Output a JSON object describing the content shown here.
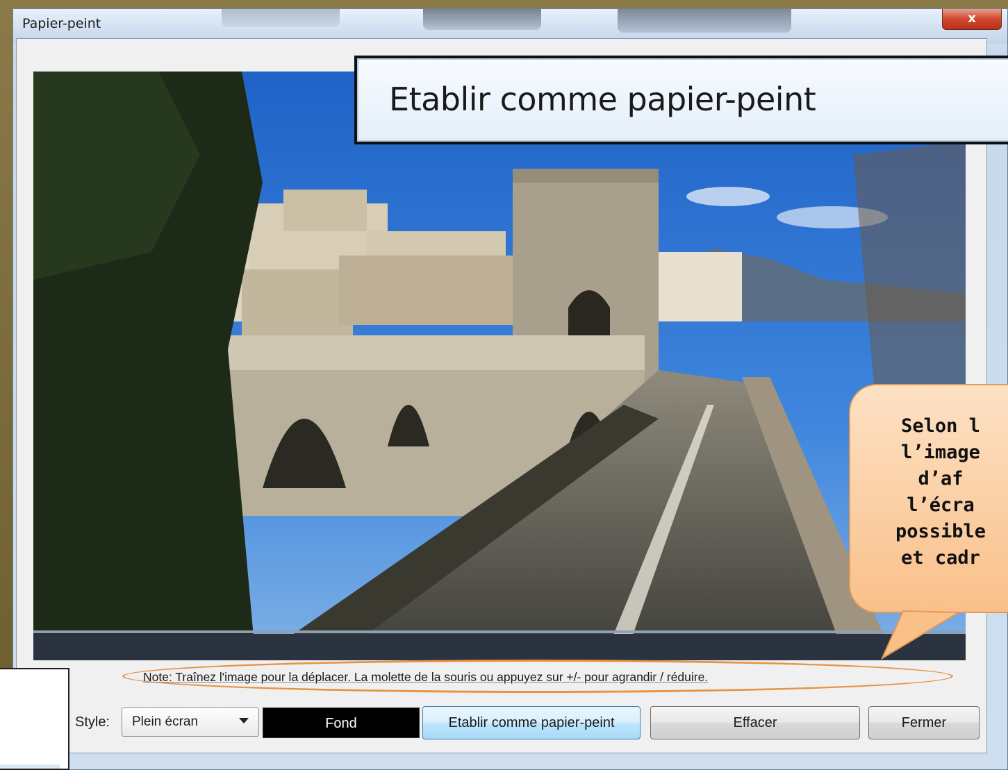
{
  "window": {
    "title": "Papier-peint",
    "close_label": "x"
  },
  "callout_menu": {
    "label": "Etablir comme papier-peint"
  },
  "bubble": {
    "lines": [
      "Selon l",
      "l’image",
      "d’af",
      "l’écra",
      "possible",
      "et cadr"
    ]
  },
  "note": {
    "text": "Note: Traînez l'image pour la déplacer. La molette de la souris ou appuyez sur +/- pour agrandir / réduire."
  },
  "controls": {
    "style_label": "Style:",
    "style_value": "Plein écran",
    "fond_label": "Fond",
    "set_wallpaper_label": "Etablir comme papier-peint",
    "clear_label": "Effacer",
    "close_label": "Fermer"
  },
  "colors": {
    "accent_ellipse": "#e69343",
    "bubble_fill": "#f9c08a"
  }
}
